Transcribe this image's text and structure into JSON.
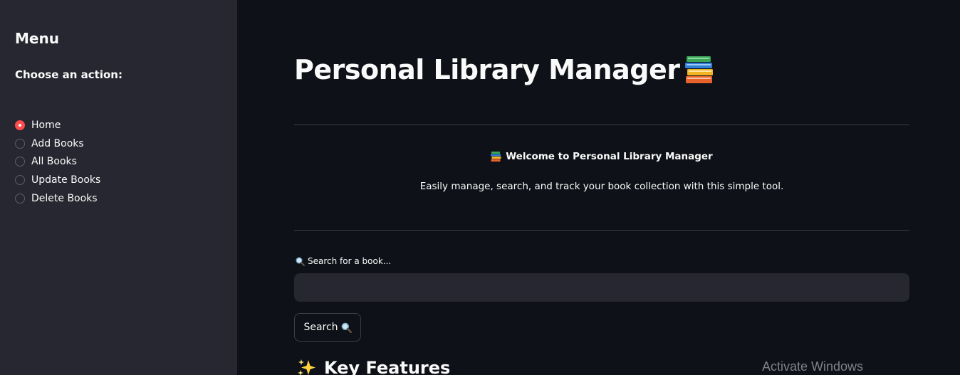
{
  "sidebar": {
    "heading": "Menu",
    "radio_label": "Choose an action:",
    "options": [
      {
        "label": "Home",
        "selected": true
      },
      {
        "label": "Add Books",
        "selected": false
      },
      {
        "label": "All Books",
        "selected": false
      },
      {
        "label": "Update Books",
        "selected": false
      },
      {
        "label": "Delete Books",
        "selected": false
      }
    ]
  },
  "main": {
    "title": "Personal Library Manager",
    "title_icon": "books-icon",
    "welcome_text": "Welcome to Personal Library Manager",
    "subtitle": "Easily manage, search, and track your book collection with this simple tool.",
    "search_label": "Search for a book...",
    "search_value": "",
    "search_button_label": "Search",
    "features_heading": "Key Features"
  },
  "watermark": "Activate Windows",
  "colors": {
    "accent": "#ff4b4b",
    "background": "#0e1117",
    "sidebar": "#262730"
  }
}
